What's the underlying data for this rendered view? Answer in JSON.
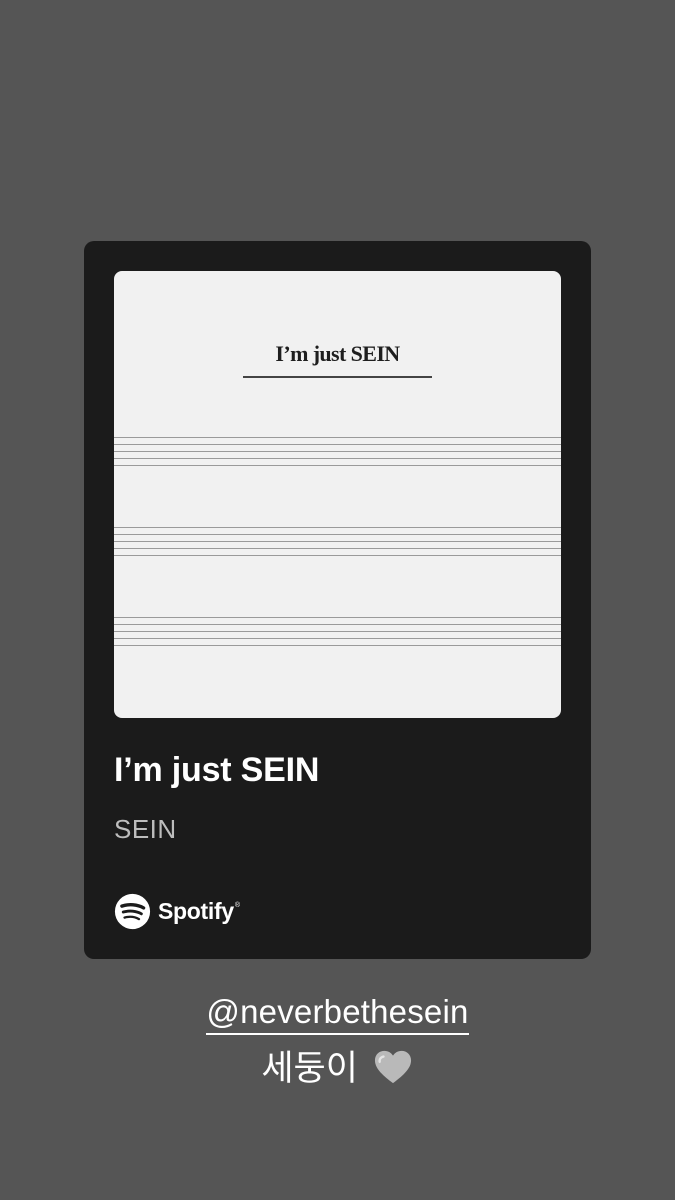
{
  "story": {
    "background_color": "#555555"
  },
  "spotify_card": {
    "cover": {
      "title": "I’m just SEIN"
    },
    "song_title": "I’m just SEIN",
    "artist": "SEIN",
    "brand": "Spotify",
    "brand_tm": "®",
    "brand_icon": "spotify-icon"
  },
  "caption": {
    "mention": "@neverbethesein",
    "text": "세둥이",
    "emoji": "grey-heart-icon"
  }
}
